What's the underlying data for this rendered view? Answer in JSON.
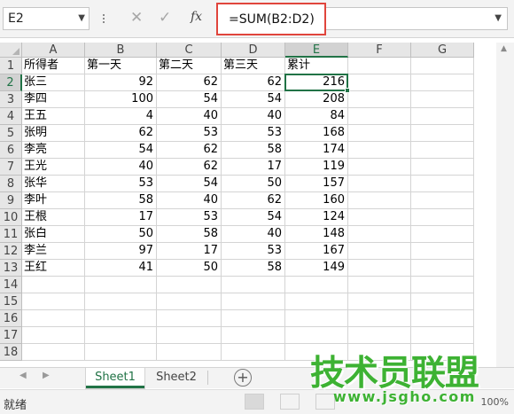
{
  "formula_bar": {
    "name_box": "E2",
    "cancel_icon": "✕",
    "enter_icon": "✓",
    "fx_label": "fx",
    "formula": "=SUM(B2:D2)"
  },
  "columns": [
    "A",
    "B",
    "C",
    "D",
    "E",
    "F",
    "G"
  ],
  "row_numbers": [
    "1",
    "2",
    "3",
    "4",
    "5",
    "6",
    "7",
    "8",
    "9",
    "10",
    "11",
    "12",
    "13",
    "14",
    "15",
    "16",
    "17",
    "18"
  ],
  "header_row": [
    "所得者",
    "第一天",
    "第二天",
    "第三天",
    "累计"
  ],
  "rows": [
    [
      "张三",
      "92",
      "62",
      "62",
      "216"
    ],
    [
      "李四",
      "100",
      "54",
      "54",
      "208"
    ],
    [
      "王五",
      "4",
      "40",
      "40",
      "84"
    ],
    [
      "张明",
      "62",
      "53",
      "53",
      "168"
    ],
    [
      "李亮",
      "54",
      "62",
      "58",
      "174"
    ],
    [
      "王光",
      "40",
      "62",
      "17",
      "119"
    ],
    [
      "张华",
      "53",
      "54",
      "50",
      "157"
    ],
    [
      "李叶",
      "58",
      "40",
      "62",
      "160"
    ],
    [
      "王根",
      "17",
      "53",
      "54",
      "124"
    ],
    [
      "张白",
      "50",
      "58",
      "40",
      "148"
    ],
    [
      "李兰",
      "97",
      "17",
      "53",
      "167"
    ],
    [
      "王红",
      "41",
      "50",
      "58",
      "149"
    ]
  ],
  "sheets": {
    "tab1": "Sheet1",
    "tab2": "Sheet2",
    "add": "+"
  },
  "status": {
    "ready": "就绪",
    "zoom": "100%"
  },
  "watermark": {
    "title": "技术员联盟",
    "url": "www.jsgho.com"
  },
  "colors": {
    "accent": "#217346",
    "highlight": "#e0453c",
    "watermark": "#3db233"
  }
}
